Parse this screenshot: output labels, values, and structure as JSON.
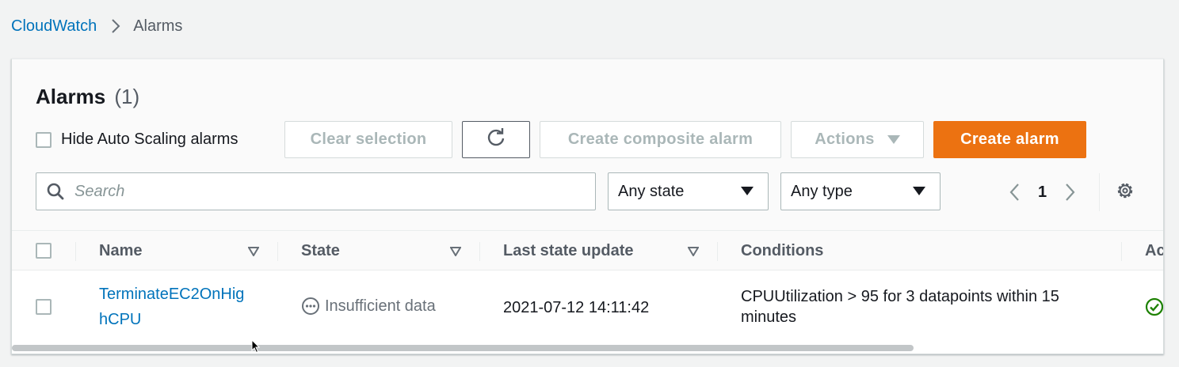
{
  "breadcrumb": {
    "parent": "CloudWatch",
    "current": "Alarms"
  },
  "header": {
    "title": "Alarms",
    "count": "(1)"
  },
  "filters": {
    "hide_autoscaling_label": "Hide Auto Scaling alarms",
    "search_placeholder": "Search",
    "state_select": "Any state",
    "type_select": "Any type"
  },
  "toolbar": {
    "clear_selection": "Clear selection",
    "create_composite": "Create composite alarm",
    "actions": "Actions",
    "create_alarm": "Create alarm"
  },
  "pagination": {
    "page": "1"
  },
  "table": {
    "columns": [
      "Name",
      "State",
      "Last state update",
      "Conditions",
      "Ac"
    ],
    "rows": [
      {
        "name_line1": "TerminateEC2OnHig",
        "name_line2": "hCPU",
        "state": "Insufficient data",
        "last_update": "2021-07-12 14:11:42",
        "cond_line1": "CPUUtilization > 95 for 3 datapoints within 15",
        "cond_line2": "minutes"
      }
    ]
  },
  "colors": {
    "link": "#0073bb",
    "primary_button": "#ec7211",
    "success": "#1d8102",
    "disabled_text": "#aab7b8"
  },
  "icons": [
    "chevron-right-icon",
    "refresh-icon",
    "caret-down-icon",
    "search-icon",
    "chevron-left-icon",
    "gear-icon",
    "sort-caret-icon",
    "ellipsis-circle-icon",
    "check-circle-icon",
    "mouse-pointer-icon"
  ]
}
